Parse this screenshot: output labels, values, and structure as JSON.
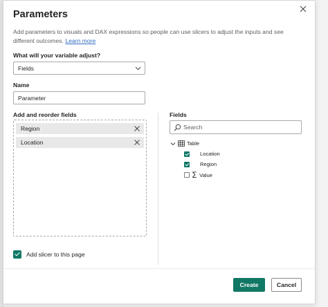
{
  "dialog": {
    "title": "Parameters",
    "description": "Add parameters to visuals and DAX expressions so people can use slicers to adjust the inputs and see different outcomes.",
    "learn_more": "Learn more"
  },
  "adjust": {
    "label": "What will your variable adjust?",
    "selected": "Fields"
  },
  "name": {
    "label": "Name",
    "value": "Parameter"
  },
  "field_well": {
    "label": "Add and reorder fields",
    "items": [
      {
        "label": "Region"
      },
      {
        "label": "Location"
      }
    ]
  },
  "fields_pane": {
    "label": "Fields",
    "search_placeholder": "Search",
    "table_name": "Table",
    "items": [
      {
        "label": "Location",
        "checked": true,
        "icon": "none"
      },
      {
        "label": "Region",
        "checked": true,
        "icon": "none"
      },
      {
        "label": "Value",
        "checked": false,
        "icon": "sigma-icon"
      }
    ]
  },
  "slicer": {
    "label": "Add slicer to this page",
    "checked": true
  },
  "buttons": {
    "create": "Create",
    "cancel": "Cancel"
  },
  "colors": {
    "accent": "#117865",
    "link": "#2f6ac1"
  }
}
